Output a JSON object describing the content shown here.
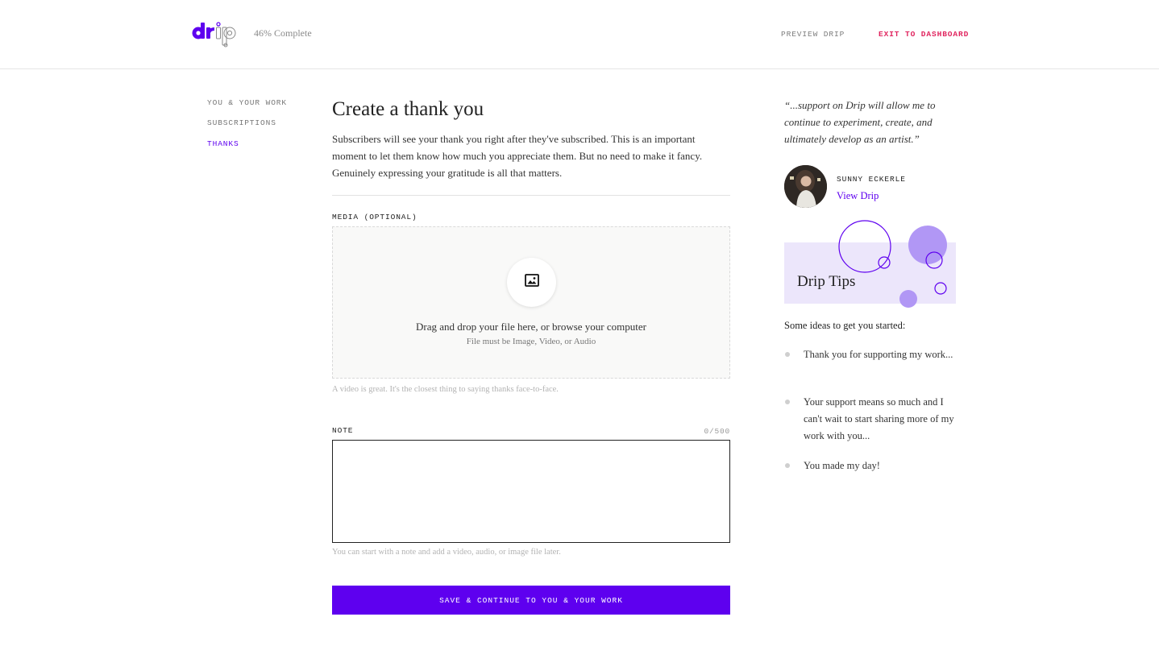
{
  "header": {
    "logo_text": "drip",
    "progress_text": "46% Complete",
    "preview_label": "PREVIEW DRIP",
    "exit_label": "EXIT TO DASHBOARD"
  },
  "nav": {
    "items": [
      {
        "label": "YOU & YOUR WORK",
        "active": false
      },
      {
        "label": "SUBSCRIPTIONS",
        "active": false
      },
      {
        "label": "THANKS",
        "active": true
      }
    ]
  },
  "main": {
    "title": "Create a thank you",
    "intro": "Subscribers will see your thank you right after they've subscribed. This is an important moment to let them know how much you appreciate them. But no need to make it fancy. Genuinely expressing your gratitude is all that matters.",
    "media": {
      "label": "MEDIA (OPTIONAL)",
      "icon": "image-icon",
      "drop_text": "Drag and drop your file here, or browse your computer",
      "drop_subtext": "File must be Image, Video, or Audio",
      "hint": "A video is great. It's the closest thing to saying thanks face-to-face."
    },
    "note": {
      "label": "NOTE",
      "counter": "0/500",
      "value": "",
      "hint": "You can start with a note and add a video, audio, or image file later."
    },
    "save_button": "SAVE & CONTINUE TO YOU & YOUR WORK"
  },
  "sidebar": {
    "quote": "“...support on Drip will allow me to continue to experiment, create, and ultimately develop as an artist.”",
    "author": {
      "name": "SUNNY ECKERLE",
      "link": "View Drip"
    },
    "tips": {
      "title": "Drip Tips",
      "intro": "Some ideas to get you started:",
      "items": [
        "Thank you for supporting my work...",
        "Your support means so much and I can't wait to start sharing more of my work with you...",
        "You made my day!"
      ]
    }
  },
  "colors": {
    "accent": "#5e00ef",
    "exit": "#e0245e",
    "tips_bg": "#ece6fb",
    "tips_circle": "#b197f5"
  }
}
